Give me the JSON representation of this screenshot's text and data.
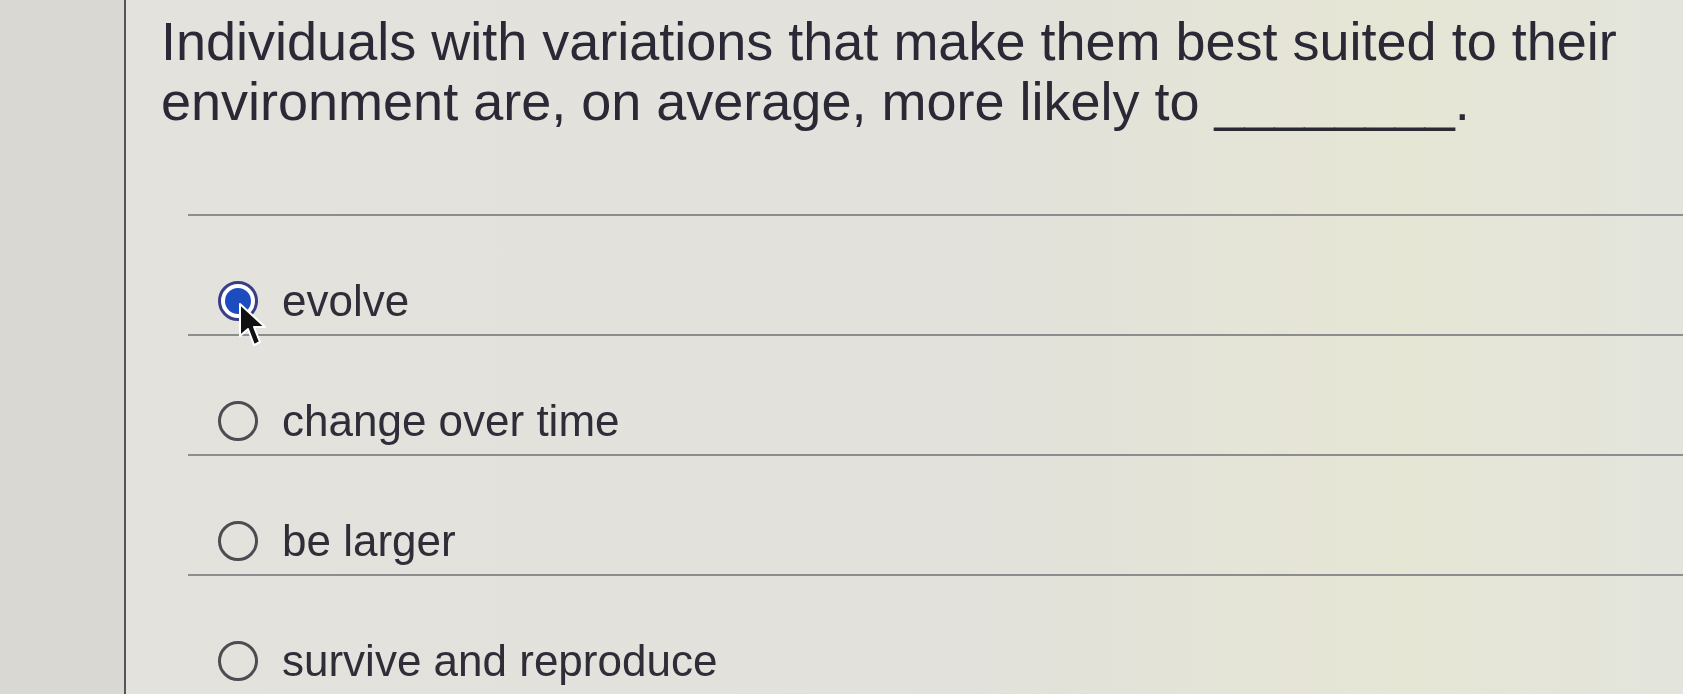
{
  "question": {
    "text": "Individuals with variations that make them best suited to their environment are, on average, more likely to ________."
  },
  "options": [
    {
      "label": "evolve",
      "selected": true
    },
    {
      "label": "change over time",
      "selected": false
    },
    {
      "label": "be larger",
      "selected": false
    },
    {
      "label": "survive and reproduce",
      "selected": false
    }
  ]
}
